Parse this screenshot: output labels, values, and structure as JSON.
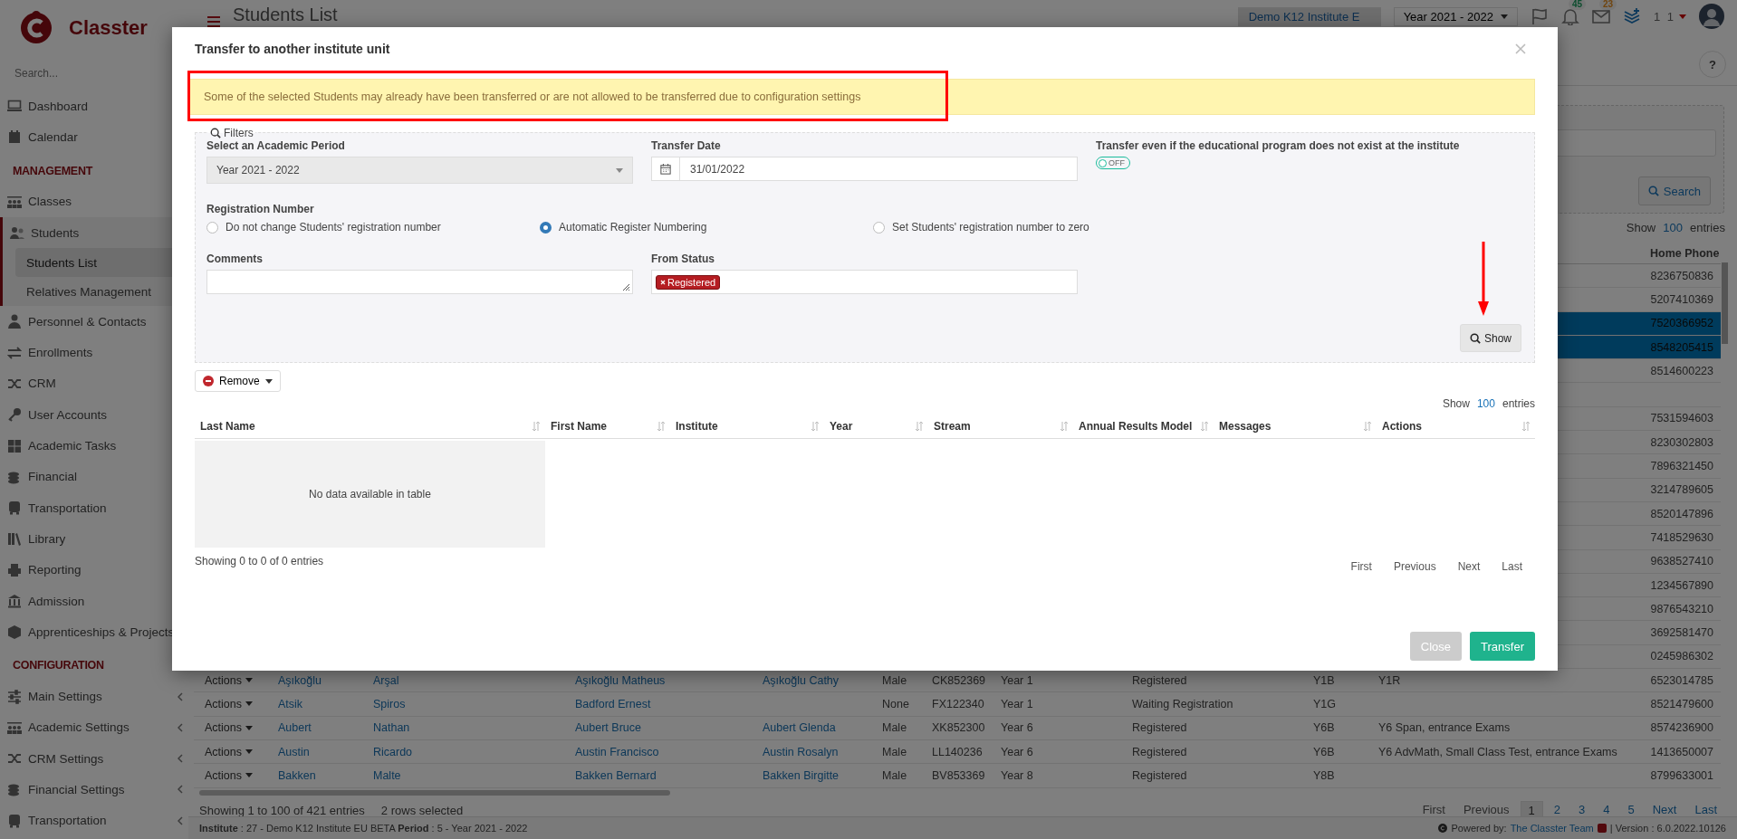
{
  "sidebar": {
    "logo_text": "Classter",
    "search_placeholder": "Search...",
    "sections": [
      {
        "items": [
          {
            "label": "Dashboard",
            "kind": "link",
            "selected": false,
            "expanded": false
          },
          {
            "label": "Calendar",
            "kind": "link",
            "selected": false,
            "expanded": false
          }
        ]
      },
      {
        "heading": "MANAGEMENT",
        "items": [
          {
            "label": "Classes",
            "kind": "link",
            "selected": false,
            "expanded": false
          },
          {
            "label": "Students",
            "kind": "menu",
            "expanded": true,
            "children": [
              {
                "label": "Students List",
                "selected": true
              },
              {
                "label": "Relatives Management",
                "selected": false
              }
            ]
          },
          {
            "label": "Personnel & Contacts",
            "kind": "link",
            "selected": false,
            "expanded": false
          },
          {
            "label": "Enrollments",
            "kind": "link",
            "selected": false,
            "expanded": false
          },
          {
            "label": "CRM",
            "kind": "link",
            "selected": false,
            "expanded": false
          },
          {
            "label": "User Accounts",
            "kind": "link",
            "selected": false,
            "expanded": false
          },
          {
            "label": "Academic Tasks",
            "kind": "link",
            "selected": false,
            "expanded": false
          },
          {
            "label": "Financial",
            "kind": "link",
            "selected": false,
            "expanded": false
          },
          {
            "label": "Transportation",
            "kind": "link",
            "selected": false,
            "expanded": false
          },
          {
            "label": "Library",
            "kind": "link",
            "selected": false,
            "expanded": false
          },
          {
            "label": "Reporting",
            "kind": "link",
            "selected": false,
            "expanded": false
          },
          {
            "label": "Admission",
            "kind": "link",
            "selected": false,
            "expanded": false
          },
          {
            "label": "Apprenticeships & Projects",
            "kind": "link",
            "selected": false,
            "expanded": false
          }
        ]
      },
      {
        "heading": "CONFIGURATION",
        "items": [
          {
            "label": "Main Settings",
            "kind": "menu",
            "selected": false,
            "expanded": false
          },
          {
            "label": "Academic Settings",
            "kind": "menu",
            "selected": false,
            "expanded": false
          },
          {
            "label": "CRM Settings",
            "kind": "menu",
            "selected": false,
            "expanded": false
          },
          {
            "label": "Financial Settings",
            "kind": "menu",
            "selected": false,
            "expanded": false
          },
          {
            "label": "Transportation",
            "kind": "menu",
            "selected": false,
            "expanded": false
          }
        ]
      }
    ]
  },
  "header": {
    "page_title": "Students List",
    "institute": "Demo K12 Institute E",
    "year": "Year 2021 - 2022",
    "notifications": "45",
    "messages": "23",
    "user": "1 1"
  },
  "page": {
    "help": "?",
    "search_button": "Search",
    "page_size": {
      "prefix": "Show",
      "value": "100",
      "suffix": "entries"
    },
    "table": {
      "home_phone_header": "Home Phone",
      "rows": [
        {
          "selected": false,
          "home_phone": "8236750836"
        },
        {
          "selected": false,
          "home_phone": "5207410369"
        },
        {
          "selected": true,
          "home_phone": "7520366952"
        },
        {
          "selected": true,
          "home_phone": "8548205415"
        },
        {
          "selected": false,
          "home_phone": "8514600223"
        },
        {
          "selected": false
        },
        {
          "selected": false,
          "home_phone": "7531594603"
        },
        {
          "selected": false,
          "home_phone": "8230302803"
        },
        {
          "selected": false,
          "home_phone": "7896321450"
        },
        {
          "selected": false,
          "home_phone": "3214789605"
        },
        {
          "selected": false,
          "home_phone": "8520147896"
        },
        {
          "selected": false,
          "home_phone": "7418529630"
        },
        {
          "selected": false,
          "home_phone": "9638527410"
        },
        {
          "selected": false,
          "home_phone": "1234567890"
        },
        {
          "selected": false,
          "home_phone": "9876543210"
        },
        {
          "selected": false,
          "home_phone": "3692581470"
        },
        {
          "selected": false,
          "home_phone": "0245986302"
        },
        {
          "selected": false,
          "actions": "Actions",
          "column_2": "Aşıkoğlu",
          "column_3": "Arşal",
          "column_4": "Aşıkoğlu Matheus",
          "column_5": "Aşıkoğlu Cathy",
          "column_6": "Male",
          "column_7": "CK852369",
          "column_8": "Year 1",
          "column_9": "Registered",
          "column_10": "Y1B",
          "column_11": "Y1R",
          "home_phone": "6523014785"
        },
        {
          "selected": false,
          "actions": "Actions",
          "column_2": "Atsik",
          "column_3": "Spiros",
          "column_4": "Badford Ernest",
          "column_6": "None",
          "column_7": "FX122340",
          "column_8": "Year 1",
          "column_9": "Waiting Registration",
          "column_10": "Y1G",
          "home_phone": "8521479600"
        },
        {
          "selected": false,
          "actions": "Actions",
          "column_2": "Aubert",
          "column_3": "Nathan",
          "column_4": "Aubert Bruce",
          "column_5": "Aubert Glenda",
          "column_6": "Male",
          "column_7": "XK852300",
          "column_8": "Year 6",
          "column_9": "Registered",
          "column_10": "Y6B",
          "column_11": "Y6 Span, entrance Exams",
          "home_phone": "8574236900"
        },
        {
          "selected": false,
          "actions": "Actions",
          "column_2": "Austin",
          "column_3": "Ricardo",
          "column_4": "Austin Francisco",
          "column_5": "Austin Rosalyn",
          "column_6": "Male",
          "column_7": "LL140236",
          "column_8": "Year 6",
          "column_9": "Registered",
          "column_10": "Y6B",
          "column_11": "Y6 AdvMath, Small Class Test, entrance Exams",
          "home_phone": "1413650007"
        },
        {
          "selected": false,
          "actions": "Actions",
          "column_2": "Bakken",
          "column_3": "Malte",
          "column_4": "Bakken Bernard",
          "column_5": "Bakken Birgitte",
          "column_6": "Male",
          "column_7": "BV853369",
          "column_8": "Year 8",
          "column_9": "Registered",
          "column_10": "Y8B",
          "home_phone": "8799633001"
        }
      ]
    },
    "table_info": "Showing 1 to 100 of 421 entries",
    "selection_info": "2 rows selected",
    "pagination": [
      {
        "label": "First",
        "selected": false
      },
      {
        "label": "Previous",
        "selected": false
      },
      {
        "label": "1",
        "selected": true
      },
      {
        "label": "2",
        "selected": false
      },
      {
        "label": "3",
        "selected": false
      },
      {
        "label": "4",
        "selected": false
      },
      {
        "label": "5",
        "selected": false
      },
      {
        "label": "Next",
        "selected": false
      },
      {
        "label": "Last",
        "selected": false
      }
    ],
    "footer": {
      "info": "**Institute** : 27 - Demo K12 Institute EU BETA **Period** : 5 - Year 2021 - 2022",
      "powered_by": "Powered by:",
      "team": "The Classter Team",
      "version": "| Version : 6.0.2022.10126"
    }
  },
  "modal": {
    "title": "Transfer to another institute unit",
    "warning": "Some of the selected Students may already have been transferred or are not allowed to be transferred due to configuration settings",
    "filters": {
      "legend": "Filters",
      "academic_period": {
        "label": "Select an Academic Period",
        "value": "Year 2021 - 2022",
        "disabled": true
      },
      "transfer_date": {
        "label": "Transfer Date",
        "value": "31/01/2022"
      },
      "transfer_even": {
        "label": "Transfer even if the educational program does not exist at the institute",
        "on": false,
        "state_text": "OFF"
      },
      "registration_number": {
        "label": "Registration Number",
        "options": [
          {
            "label": "Do not change Students' registration number",
            "selected": false
          },
          {
            "label": "Automatic Register Numbering",
            "selected": true
          },
          {
            "label": "Set Students' registration number to zero",
            "selected": false
          }
        ]
      },
      "comments": {
        "label": "Comments"
      },
      "from_status": {
        "label": "From Status",
        "tags": [
          "Registered"
        ]
      },
      "show_button": "Show"
    },
    "remove_button": "Remove",
    "page_size": {
      "prefix": "Show",
      "value": "100",
      "suffix": "entries"
    },
    "table": {
      "columns": [
        "Last Name",
        "First Name",
        "Institute",
        "Year",
        "Stream",
        "Annual Results Model",
        "Messages",
        "Actions"
      ],
      "empty_text": "No data available in table"
    },
    "info": "Showing 0 to 0 of 0 entries",
    "pagination": [
      "First",
      "Previous",
      "Next",
      "Last"
    ],
    "buttons": [
      {
        "label": "Close",
        "kind": "secondary"
      },
      {
        "label": "Transfer",
        "kind": "primary"
      }
    ]
  }
}
